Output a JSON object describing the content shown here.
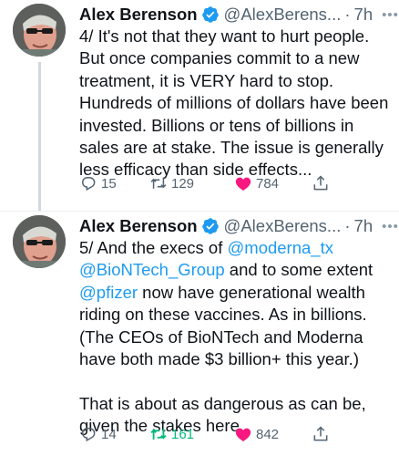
{
  "tweets": [
    {
      "author": "Alex Berenson",
      "handle": "@AlexBerens...",
      "separator": "·",
      "time": "7h",
      "more": "•••",
      "lines": [
        [
          {
            "t": "4/ It's not that they want to hurt people."
          }
        ],
        [
          {
            "t": "But once companies commit to a new"
          }
        ],
        [
          {
            "t": "treatment, it is VERY hard to stop."
          }
        ],
        [
          {
            "t": "Hundreds of millions of dollars have been"
          }
        ],
        [
          {
            "t": "invested. Billions or tens of billions in"
          }
        ],
        [
          {
            "t": "sales are at stake. The issue is generally"
          }
        ],
        [
          {
            "t": "less efficacy than side effects..."
          }
        ]
      ],
      "replies": "15",
      "retweets": "129",
      "likes": "784",
      "retweeted": false,
      "liked": true
    },
    {
      "author": "Alex Berenson",
      "handle": "@AlexBerens...",
      "separator": "·",
      "time": "7h",
      "more": "•••",
      "lines": [
        [
          {
            "t": "5/ And the execs of "
          },
          {
            "t": "@moderna_tx",
            "m": true
          }
        ],
        [
          {
            "t": "@BioNTech_Group",
            "m": true
          },
          {
            "t": " and to some extent"
          }
        ],
        [
          {
            "t": "@pfizer",
            "m": true
          },
          {
            "t": " now have generational wealth"
          }
        ],
        [
          {
            "t": "riding on these vaccines. As in billions."
          }
        ],
        [
          {
            "t": "(The CEOs of BioNTech and Moderna"
          }
        ],
        [
          {
            "t": "have both made $3 billion+ this year.)"
          }
        ],
        [],
        [
          {
            "t": "That is about as dangerous as can be,"
          }
        ],
        [
          {
            "t": "given the stakes here."
          }
        ]
      ],
      "replies": "14",
      "retweets": "161",
      "likes": "842",
      "retweeted": true,
      "liked": true
    }
  ],
  "colors": {
    "verified": "#1d9bf0",
    "mention": "#1d9bf0",
    "like": "#f91880",
    "retweet_active": "#00ba7c",
    "muted": "#536471"
  },
  "icons": {
    "verified": "verified-badge-icon",
    "reply": "reply-icon",
    "retweet": "retweet-icon",
    "like": "heart-icon",
    "share": "share-icon"
  }
}
